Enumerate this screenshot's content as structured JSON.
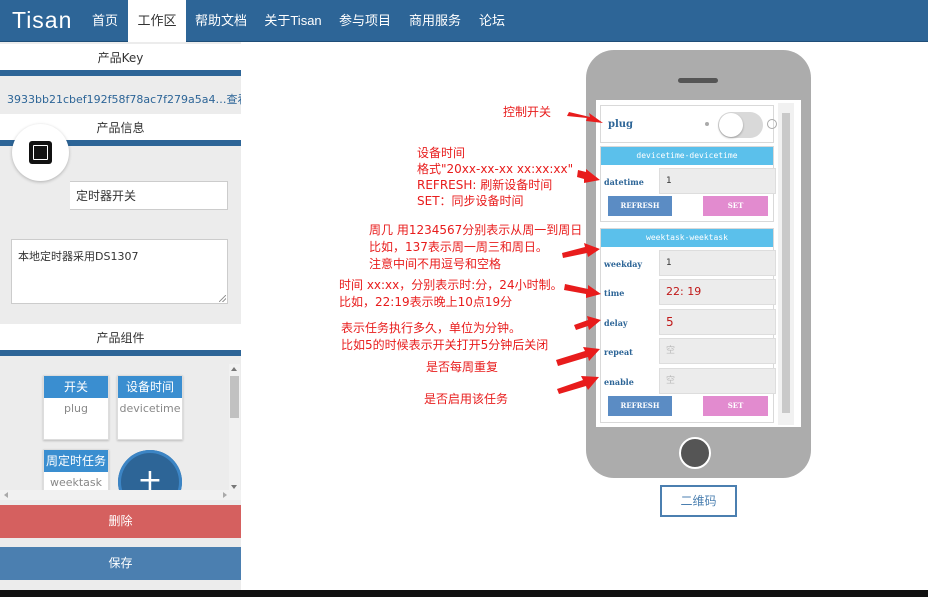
{
  "navbar": {
    "logo": "Tisan",
    "items": [
      "首页",
      "工作区",
      "帮助文档",
      "关于Tisan",
      "参与项目",
      "商用服务",
      "论坛"
    ],
    "active": "工作区"
  },
  "sidebar": {
    "key_title": "产品Key",
    "key_value": "3933bb21cbef192f58f78ac7f279a5a4…",
    "key_view_link": "查看",
    "info_title": "产品信息",
    "product_name": "定时器开关",
    "product_desc": "本地定时器采用DS1307",
    "components_title": "产品组件",
    "components": [
      {
        "title": "开关",
        "name": "plug"
      },
      {
        "title": "设备时间",
        "name": "devicetime"
      },
      {
        "title": "周定时任务",
        "name": "weektask"
      }
    ],
    "add_symbol": "+",
    "delete_label": "删除",
    "save_label": "保存"
  },
  "phone": {
    "plug_label": "plug",
    "devicetime_header": "devicetime-devicetime",
    "datetime_label": "datetime",
    "datetime_value": "1",
    "refresh_label": "REFRESH",
    "set_label": "SET",
    "weektask_header": "weektask-weektask",
    "weekday_label": "weekday",
    "weekday_value": "1",
    "time_label": "time",
    "time_value": "22: 19",
    "delay_label": "delay",
    "delay_value": "5",
    "repeat_label": "repeat",
    "enable_label": "enable",
    "empty_placeholder": "空",
    "refresh2_label": "REFRESH",
    "set2_label": "SET",
    "qr_label": "二维码"
  },
  "annotations": {
    "plug": "控制开关",
    "devtime_1": "设备时间",
    "devtime_2": "格式\"20xx-xx-xx xx:xx:xx\"",
    "devtime_3": "REFRESH: 刷新设备时间",
    "devtime_4": "SET：同步设备时间",
    "weekday_1": "周几  用1234567分别表示从周一到周日",
    "weekday_2": "比如，137表示周一周三和周日。",
    "weekday_3": "注意中间不用逗号和空格",
    "time_1": "时间  xx:xx，分别表示时:分，24小时制。",
    "time_2": "比如，22:19表示晚上10点19分",
    "delay_1": "表示任务执行多久，单位为分钟。",
    "delay_2": "比如5的时候表示开关打开5分钟后关闭",
    "repeat": "是否每周重复",
    "enable": "是否启用该任务"
  },
  "colors": {
    "nav": "#2d6597",
    "accent": "#5bc0eb",
    "delete": "#d5605f",
    "save": "#4b7fb0",
    "annotation": "#e81c1c",
    "set_button": "#e28bcf"
  }
}
